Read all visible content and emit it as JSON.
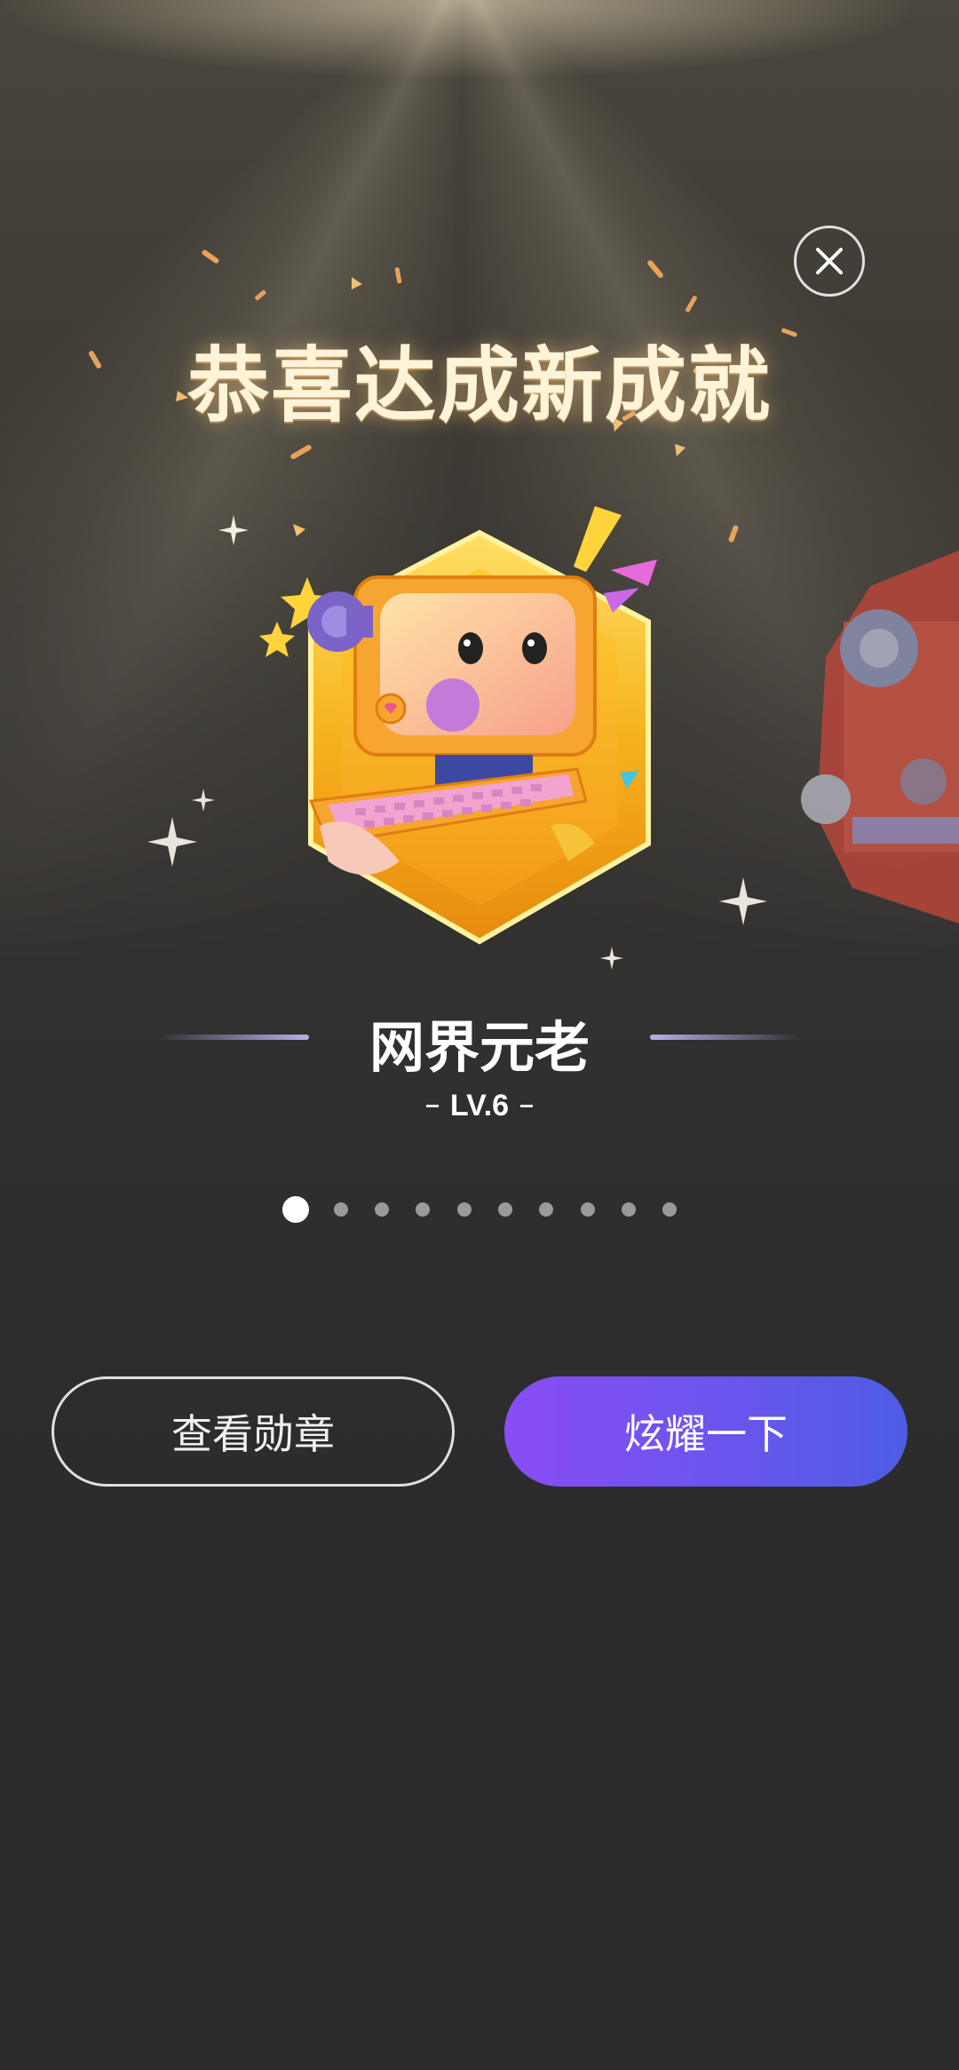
{
  "dialog": {
    "title": "恭喜达成新成就",
    "close_icon": "close-icon",
    "badge": {
      "name": "网界元老",
      "level": "LV.6",
      "icon": "retro-computer-badge-icon"
    },
    "pagination": {
      "total": 10,
      "active_index": 0
    },
    "buttons": {
      "view_badges": "查看勋章",
      "show_off": "炫耀一下"
    }
  },
  "colors": {
    "background": "#2a2a2c",
    "primary_gradient_start": "#8a4cf5",
    "primary_gradient_end": "#4d5ce4",
    "title_glow": "#fff3d8",
    "badge_gold": "#f6b21c"
  }
}
